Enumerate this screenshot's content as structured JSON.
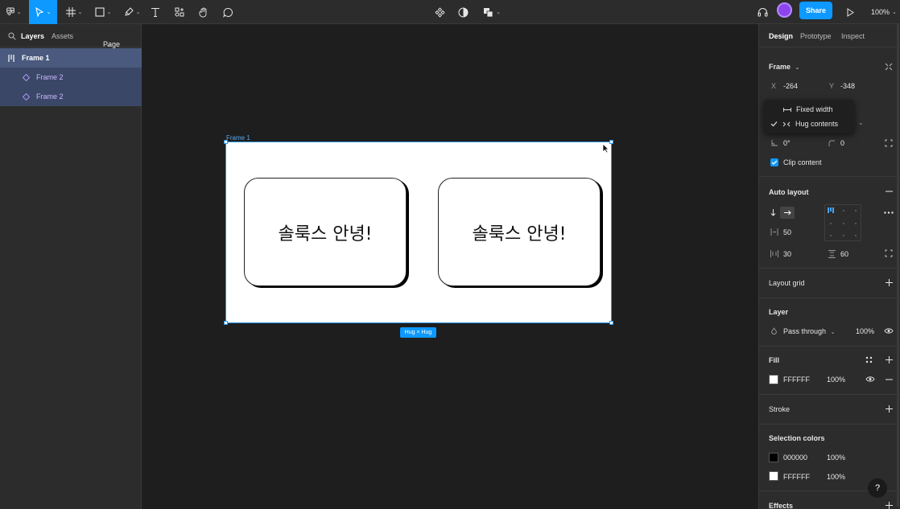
{
  "toolbar": {
    "share_label": "Share",
    "zoom_label": "100%"
  },
  "left_panel": {
    "tabs": [
      "Layers",
      "Assets"
    ],
    "page_label": "Page 1",
    "layers": [
      {
        "label": "Frame 1"
      },
      {
        "label": "Frame 2"
      },
      {
        "label": "Frame 2"
      }
    ]
  },
  "canvas": {
    "frame_label": "Frame 1",
    "cards": [
      {
        "text": "솔룩스 안녕!"
      },
      {
        "text": "솔룩스 안녕!"
      }
    ],
    "size_badge": "Hug × Hug"
  },
  "right_panel": {
    "tabs": [
      "Design",
      "Prototype",
      "Inspect"
    ],
    "frame_title": "Frame",
    "x_label": "X",
    "x_value": "-264",
    "y_label": "Y",
    "y_value": "-348",
    "rotation_value": "0°",
    "radius_value": "0",
    "clip_content_label": "Clip content",
    "auto_layout_title": "Auto layout",
    "gap_value": "50",
    "padding_h_value": "30",
    "padding_v_value": "60",
    "layout_grid_title": "Layout grid",
    "layer_title": "Layer",
    "blend_mode": "Pass through",
    "layer_opacity": "100%",
    "fill_title": "Fill",
    "fill_hex": "FFFFFF",
    "fill_opacity": "100%",
    "stroke_title": "Stroke",
    "selection_colors_title": "Selection colors",
    "selection_colors": [
      {
        "hex": "000000",
        "opacity": "100%",
        "swatch": "#000000"
      },
      {
        "hex": "FFFFFF",
        "opacity": "100%",
        "swatch": "#ffffff"
      }
    ],
    "effects_title": "Effects"
  },
  "dropdown": {
    "items": [
      {
        "label": "Fixed width",
        "checked": false
      },
      {
        "label": "Hug contents",
        "checked": true
      }
    ]
  },
  "help_label": "?",
  "colors": {
    "accent": "#0d99ff",
    "panel_bg": "#2c2c2c",
    "canvas_bg": "#1e1e1e"
  }
}
